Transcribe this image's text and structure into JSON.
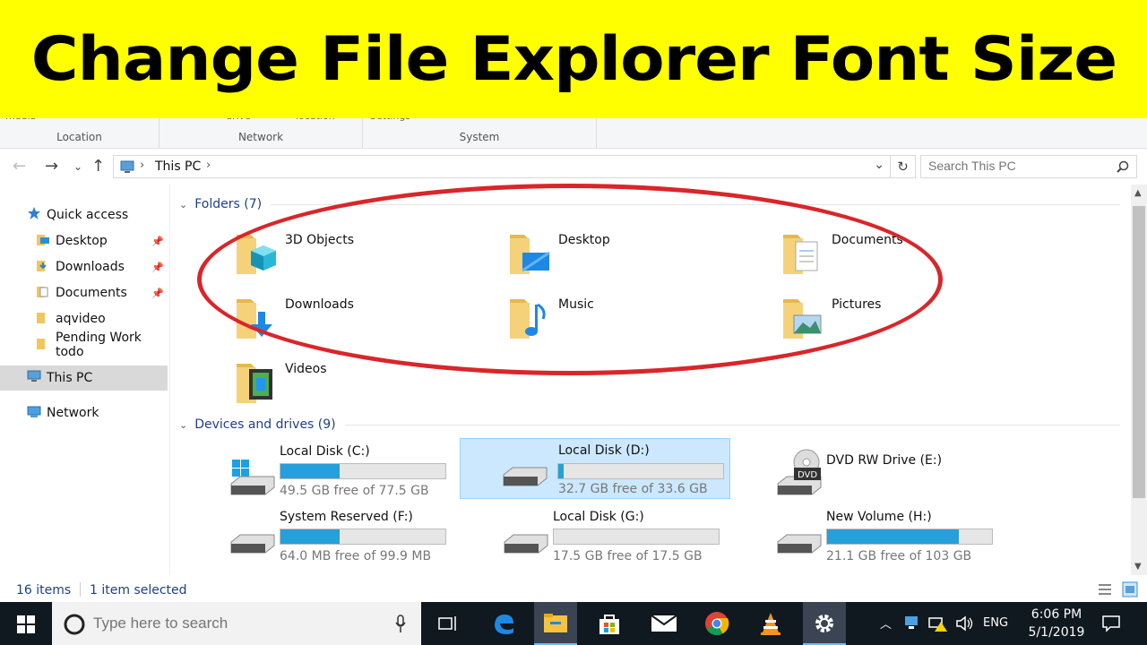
{
  "banner": {
    "title": "Change File Explorer Font Size"
  },
  "ribbon": {
    "groups": [
      {
        "label": "Location",
        "top": "media"
      },
      {
        "label": "Network",
        "top": "drive"
      },
      {
        "label": "System",
        "top": "Settings"
      }
    ],
    "extra_top": "location"
  },
  "address": {
    "path": "This PC"
  },
  "search": {
    "placeholder": "Search This PC"
  },
  "sidebar": {
    "items": [
      {
        "label": "Quick access"
      },
      {
        "label": "Desktop"
      },
      {
        "label": "Downloads"
      },
      {
        "label": "Documents"
      },
      {
        "label": "aqvideo"
      },
      {
        "label": "Pending Work todo"
      },
      {
        "label": "This PC"
      },
      {
        "label": "Network"
      }
    ]
  },
  "folders_section": {
    "header": "Folders (7)"
  },
  "folders": [
    {
      "name": "3D Objects"
    },
    {
      "name": "Desktop"
    },
    {
      "name": "Documents"
    },
    {
      "name": "Downloads"
    },
    {
      "name": "Music"
    },
    {
      "name": "Pictures"
    },
    {
      "name": "Videos"
    }
  ],
  "drives_section": {
    "header": "Devices and drives (9)"
  },
  "drives": [
    {
      "name": "Local Disk (C:)",
      "free": "49.5 GB free of 77.5 GB",
      "used_fraction": 0.36
    },
    {
      "name": "Local Disk (D:)",
      "free": "32.7 GB free of 33.6 GB",
      "used_fraction": 0.03
    },
    {
      "name": "DVD RW Drive (E:)",
      "free": ""
    },
    {
      "name": "System Reserved (F:)",
      "free": "64.0 MB free of 99.9 MB",
      "used_fraction": 0.36
    },
    {
      "name": "Local Disk (G:)",
      "free": "17.5 GB free of 17.5 GB",
      "used_fraction": 0.0
    },
    {
      "name": "New Volume (H:)",
      "free": "21.1 GB free of 103 GB",
      "used_fraction": 0.8
    }
  ],
  "dvd_label": "DVD",
  "status": {
    "items": "16 items",
    "selected": "1 item selected"
  },
  "taskbar": {
    "search_placeholder": "Type here to search",
    "language": "ENG",
    "time": "6:06 PM",
    "date": "5/1/2019"
  },
  "colors": {
    "accent": "#26a0da",
    "selection": "#cce8ff",
    "banner": "#ffff00",
    "annotation": "#d9262a"
  }
}
